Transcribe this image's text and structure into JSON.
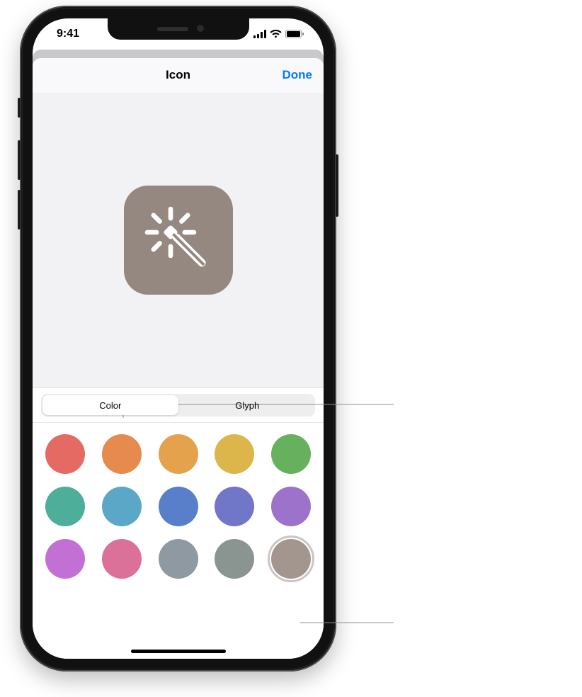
{
  "status": {
    "time": "9:41"
  },
  "nav": {
    "title": "Icon",
    "done": "Done"
  },
  "segments": {
    "color": "Color",
    "glyph": "Glyph",
    "selected": "color"
  },
  "icon": {
    "glyph": "wand-icon",
    "color": "#958881"
  },
  "colors": [
    {
      "name": "red",
      "hex": "#E56A63"
    },
    {
      "name": "orange",
      "hex": "#E68A4D"
    },
    {
      "name": "tangerine",
      "hex": "#E5A24C"
    },
    {
      "name": "yellow",
      "hex": "#DCB64A"
    },
    {
      "name": "green",
      "hex": "#66B05E"
    },
    {
      "name": "teal",
      "hex": "#4DAE9A"
    },
    {
      "name": "cyan",
      "hex": "#5AA7C8"
    },
    {
      "name": "blue",
      "hex": "#597FCB"
    },
    {
      "name": "indigo",
      "hex": "#7177C8"
    },
    {
      "name": "purple",
      "hex": "#9C72CB"
    },
    {
      "name": "magenta",
      "hex": "#C270D3"
    },
    {
      "name": "pink",
      "hex": "#DB7099"
    },
    {
      "name": "grayblue",
      "hex": "#8E99A1"
    },
    {
      "name": "slate",
      "hex": "#8A9591"
    },
    {
      "name": "taupe",
      "hex": "#A3968F"
    }
  ],
  "selected_color_index": 14
}
